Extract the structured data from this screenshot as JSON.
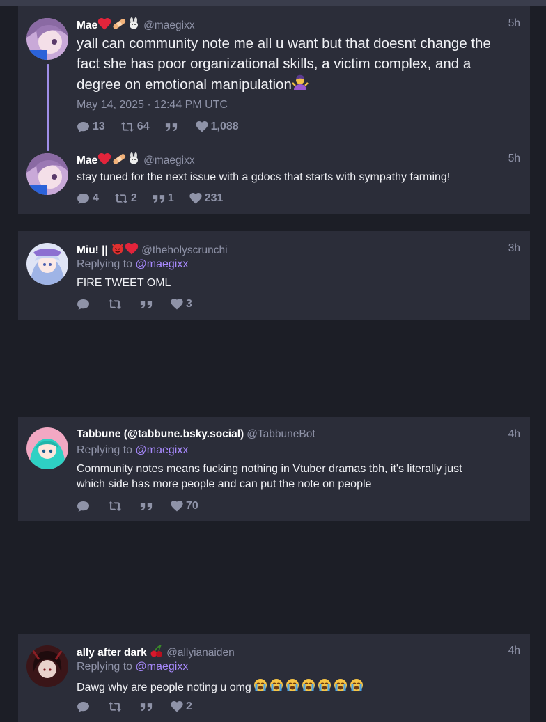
{
  "thread": {
    "posts": [
      {
        "name": "Mae",
        "handle": "@maegixx",
        "time": "5h",
        "text": "yall can community note me all u want but that doesnt change the fact she has poor organizational skills, a victim complex, and a degree on emotional manipulation",
        "date": "May 14, 2025 · 12:44 PM UTC",
        "replies": "13",
        "reposts": "64",
        "quotes": "",
        "likes": "1,088"
      },
      {
        "name": "Mae",
        "handle": "@maegixx",
        "time": "5h",
        "text": "stay tuned for the next issue with a gdocs that starts with sympathy farming!",
        "replies": "4",
        "reposts": "2",
        "quotes": "1",
        "likes": "231"
      }
    ]
  },
  "replies": [
    {
      "name": "Miu! ||",
      "handle": "@theholyscrunchi",
      "time": "3h",
      "replying_label": "Replying to",
      "replying_to": "@maegixx",
      "text": "FIRE TWEET OML",
      "likes": "3"
    },
    {
      "name": "Tabbune (@tabbune.bsky.social)",
      "handle": "@TabbuneBot",
      "time": "4h",
      "replying_label": "Replying to",
      "replying_to": "@maegixx",
      "text_line1": "Community notes means fucking nothing in Vtuber dramas tbh, it's literally just",
      "text_line2": "which side has more people and can put the note on people",
      "likes": "70"
    },
    {
      "name": "ally after dark",
      "handle": "@allyianaiden",
      "time": "4h",
      "replying_label": "Replying to",
      "replying_to": "@maegixx",
      "text": "Dawg why are people noting u omg",
      "likes": "2"
    }
  ],
  "icons": {
    "reply": "comment-icon",
    "repost": "retweet-icon",
    "quote": "quote-icon",
    "like": "heart-icon"
  },
  "colors": {
    "background": "#1c1e26",
    "card": "#2b2d39",
    "muted": "#8f93a8",
    "mention": "#a98aff",
    "thread_line": "#9f8ee8"
  }
}
